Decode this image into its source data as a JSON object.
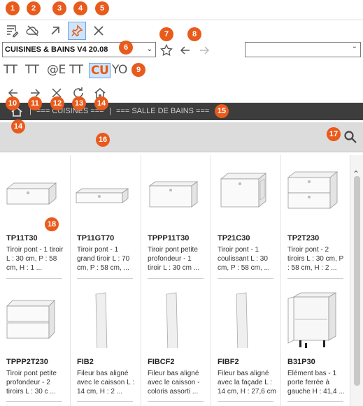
{
  "annotations": [
    "1",
    "2",
    "3",
    "4",
    "5",
    "6",
    "7",
    "8",
    "9",
    "10",
    "11",
    "12",
    "13",
    "14",
    "14",
    "15",
    "16",
    "17",
    "18"
  ],
  "toolbar": {
    "icons": [
      "list-edit-icon",
      "cloud-off-icon",
      "arrow-up-right-icon",
      "pin-icon",
      "close-icon"
    ]
  },
  "catalog_select": {
    "value": "CUISINES & BAINS V4 20.08"
  },
  "right_select": {
    "value": ""
  },
  "format_buttons": [
    "TT",
    "TT",
    "@E",
    "TT",
    "CU",
    "YO"
  ],
  "breadcrumb": {
    "sep1": "|",
    "item1": "=== CUISINES ===",
    "sep2": "|",
    "item2": "=== SALLE DE BAINS ==="
  },
  "products": [
    {
      "code": "TP11T30",
      "desc": "Tiroir pont - 1 tiroir L : 30 cm, P : 58 cm, H : 1 ..."
    },
    {
      "code": "TP11GT70",
      "desc": "Tiroir pont - 1 grand tiroir L : 70 cm, P : 58 cm, ..."
    },
    {
      "code": "TPPP11T30",
      "desc": "Tiroir pont petite profondeur - 1 tiroir L : 30 cm ..."
    },
    {
      "code": "TP21C30",
      "desc": "Tiroir pont - 1 coulissant L : 30 cm, P : 58 cm, ..."
    },
    {
      "code": "TP2T230",
      "desc": "Tiroir pont - 2 tiroirs L : 30 cm, P : 58 cm, H : 2 ..."
    },
    {
      "code": "TPPP2T230",
      "desc": "Tiroir pont petite profondeur - 2 tiroirs L : 30 c ..."
    },
    {
      "code": "FIB2",
      "desc": "Fileur bas aligné avec le caisson L : 14 cm, H : 2 ..."
    },
    {
      "code": "FIBCF2",
      "desc": "Fileur bas aligné avec le caisson - coloris assorti ..."
    },
    {
      "code": "FIBF2",
      "desc": "Fileur bas aligné avec la façade L : 14 cm, H : 27,6 cm"
    },
    {
      "code": "B31P30",
      "desc": "Elément bas - 1 porte ferrée à gauche H : 41,4 ..."
    }
  ],
  "colors": {
    "accent": "#e85b1c",
    "active_bg": "#cfe3fb",
    "dark_bar": "#3d3d3d",
    "gray_bar": "#dcdcdc"
  }
}
